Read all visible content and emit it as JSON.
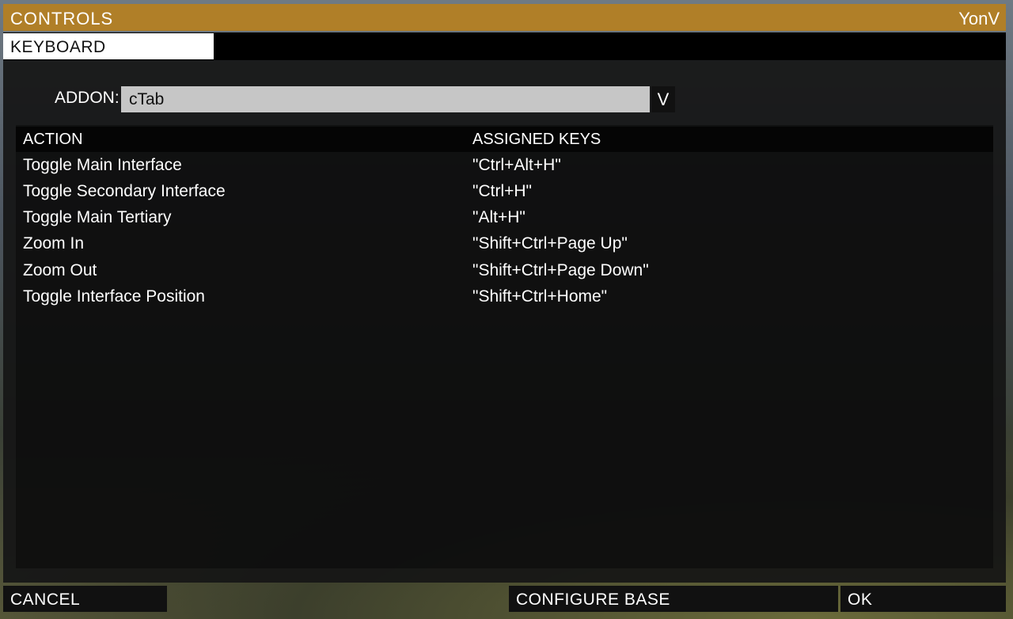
{
  "window": {
    "title": "CONTROLS",
    "user": "YonV"
  },
  "tabs": [
    {
      "label": "KEYBOARD",
      "active": true
    }
  ],
  "addon": {
    "label": "ADDON:",
    "selected": "cTab",
    "dropdown_icon": "V"
  },
  "table": {
    "headers": {
      "action": "ACTION",
      "keys": "ASSIGNED KEYS"
    },
    "rows": [
      {
        "action": "Toggle Main Interface",
        "keys": "\"Ctrl+Alt+H\""
      },
      {
        "action": "Toggle Secondary Interface",
        "keys": "\"Ctrl+H\""
      },
      {
        "action": "Toggle Main Tertiary",
        "keys": "\"Alt+H\""
      },
      {
        "action": "Zoom In",
        "keys": "\"Shift+Ctrl+Page Up\""
      },
      {
        "action": "Zoom Out",
        "keys": "\"Shift+Ctrl+Page Down\""
      },
      {
        "action": "Toggle Interface Position",
        "keys": "\"Shift+Ctrl+Home\""
      }
    ]
  },
  "buttons": {
    "cancel": "CANCEL",
    "configure_base": "CONFIGURE BASE",
    "ok": "OK"
  },
  "colors": {
    "accent": "#b07f28",
    "panel": "#161616",
    "select_bg": "#c6c6c6"
  }
}
